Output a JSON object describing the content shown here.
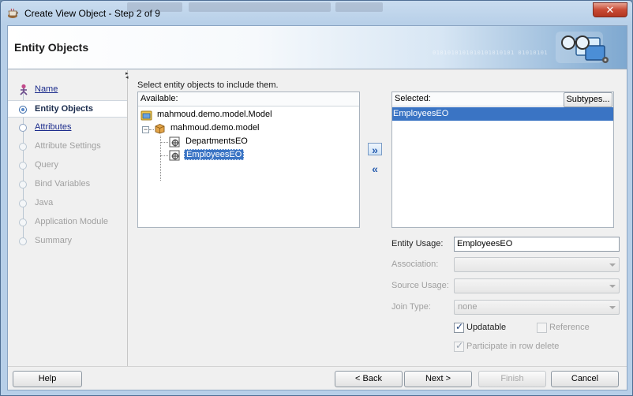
{
  "window": {
    "title": "Create View Object - Step 2 of 9",
    "close_label": "✕"
  },
  "header": {
    "title": "Entity Objects",
    "binary_text": "0101010101010101010101 01010101"
  },
  "nav": {
    "items": [
      {
        "label": "Name",
        "state": "link"
      },
      {
        "label": "Entity Objects",
        "state": "active"
      },
      {
        "label": "Attributes",
        "state": "link"
      },
      {
        "label": "Attribute Settings",
        "state": "disabled"
      },
      {
        "label": "Query",
        "state": "disabled"
      },
      {
        "label": "Bind Variables",
        "state": "disabled"
      },
      {
        "label": "Java",
        "state": "disabled"
      },
      {
        "label": "Application Module",
        "state": "disabled"
      },
      {
        "label": "Summary",
        "state": "disabled"
      }
    ]
  },
  "main": {
    "instructions": "Select entity objects to include them.",
    "available": {
      "label": "Available:",
      "tree": [
        {
          "label": "mahmoud.demo.model.Model",
          "icon": "project-folder-icon"
        },
        {
          "label": "mahmoud.demo.model",
          "icon": "package-icon"
        },
        {
          "label": "DepartmentsEO",
          "icon": "entity-object-icon"
        },
        {
          "label": "EmployeesEO",
          "icon": "entity-object-icon",
          "selected": true
        }
      ]
    },
    "shuttle": {
      "add_icon": "chevron-right-icon",
      "remove_icon": "chevron-left-icon",
      "add_glyph": "»",
      "remove_glyph": "«"
    },
    "selected": {
      "label": "Selected:",
      "subtypes_label": "Subtypes...",
      "items": [
        "EmployeesEO"
      ]
    },
    "form": {
      "entity_usage_label": "Entity Usage:",
      "entity_usage_value": "EmployeesEO",
      "association_label": "Association:",
      "association_value": "",
      "source_usage_label": "Source Usage:",
      "source_usage_value": "",
      "join_type_label": "Join Type:",
      "join_type_value": "none",
      "updatable_label": "Updatable",
      "updatable_checked": true,
      "reference_label": "Reference",
      "reference_checked": false,
      "participate_label": "Participate in row delete",
      "participate_checked": true
    }
  },
  "footer": {
    "help": "Help",
    "back": "< Back",
    "next": "Next >",
    "finish": "Finish",
    "cancel": "Cancel"
  },
  "colors": {
    "selection": "#3a74c4",
    "link": "#1b2b8c",
    "disabled_text": "#a0a0a0"
  }
}
